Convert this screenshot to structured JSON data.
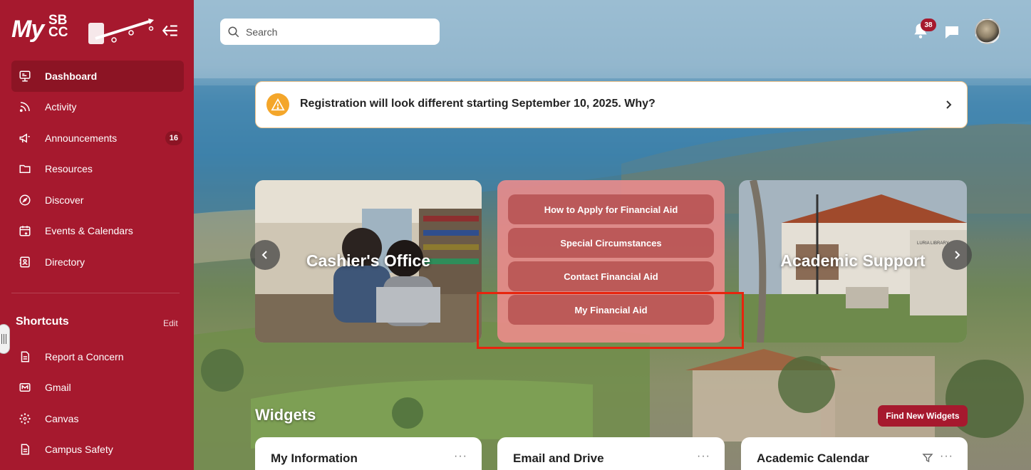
{
  "sidebar": {
    "logo": {
      "my": "My",
      "sbcc_top": "SB",
      "sbcc_bottom": "CC"
    },
    "nav": [
      {
        "label": "Dashboard",
        "icon": "dashboard-icon",
        "active": true
      },
      {
        "label": "Activity",
        "icon": "activity-icon"
      },
      {
        "label": "Announcements",
        "icon": "megaphone-icon",
        "badge": "16"
      },
      {
        "label": "Resources",
        "icon": "folder-icon"
      },
      {
        "label": "Discover",
        "icon": "compass-icon"
      },
      {
        "label": "Events & Calendars",
        "icon": "calendar-icon"
      },
      {
        "label": "Directory",
        "icon": "directory-icon"
      }
    ],
    "shortcuts_title": "Shortcuts",
    "shortcuts_edit": "Edit",
    "shortcuts": [
      {
        "label": "Report a Concern",
        "icon": "document-icon"
      },
      {
        "label": "Gmail",
        "icon": "mail-icon"
      },
      {
        "label": "Canvas",
        "icon": "canvas-icon"
      },
      {
        "label": "Campus Safety",
        "icon": "document-icon"
      }
    ]
  },
  "header": {
    "search_placeholder": "Search",
    "notifications_count": "38"
  },
  "banner": {
    "text": "Registration will look different starting September 10, 2025. Why?"
  },
  "carousel": {
    "left_card": "Cashier's Office",
    "right_card": "Academic Support",
    "financial_aid_links": [
      "How to Apply for Financial Aid",
      "Special Circumstances",
      "Contact Financial Aid",
      "My Financial Aid"
    ],
    "library_sign": "LURIA LIBRARY"
  },
  "widgets": {
    "title": "Widgets",
    "find_new": "Find New Widgets",
    "cards": [
      "My Information",
      "Email and Drive",
      "Academic Calendar"
    ]
  },
  "colors": {
    "brand": "#a6192e",
    "highlight": "#e8240d",
    "warning": "#f4a62a"
  }
}
